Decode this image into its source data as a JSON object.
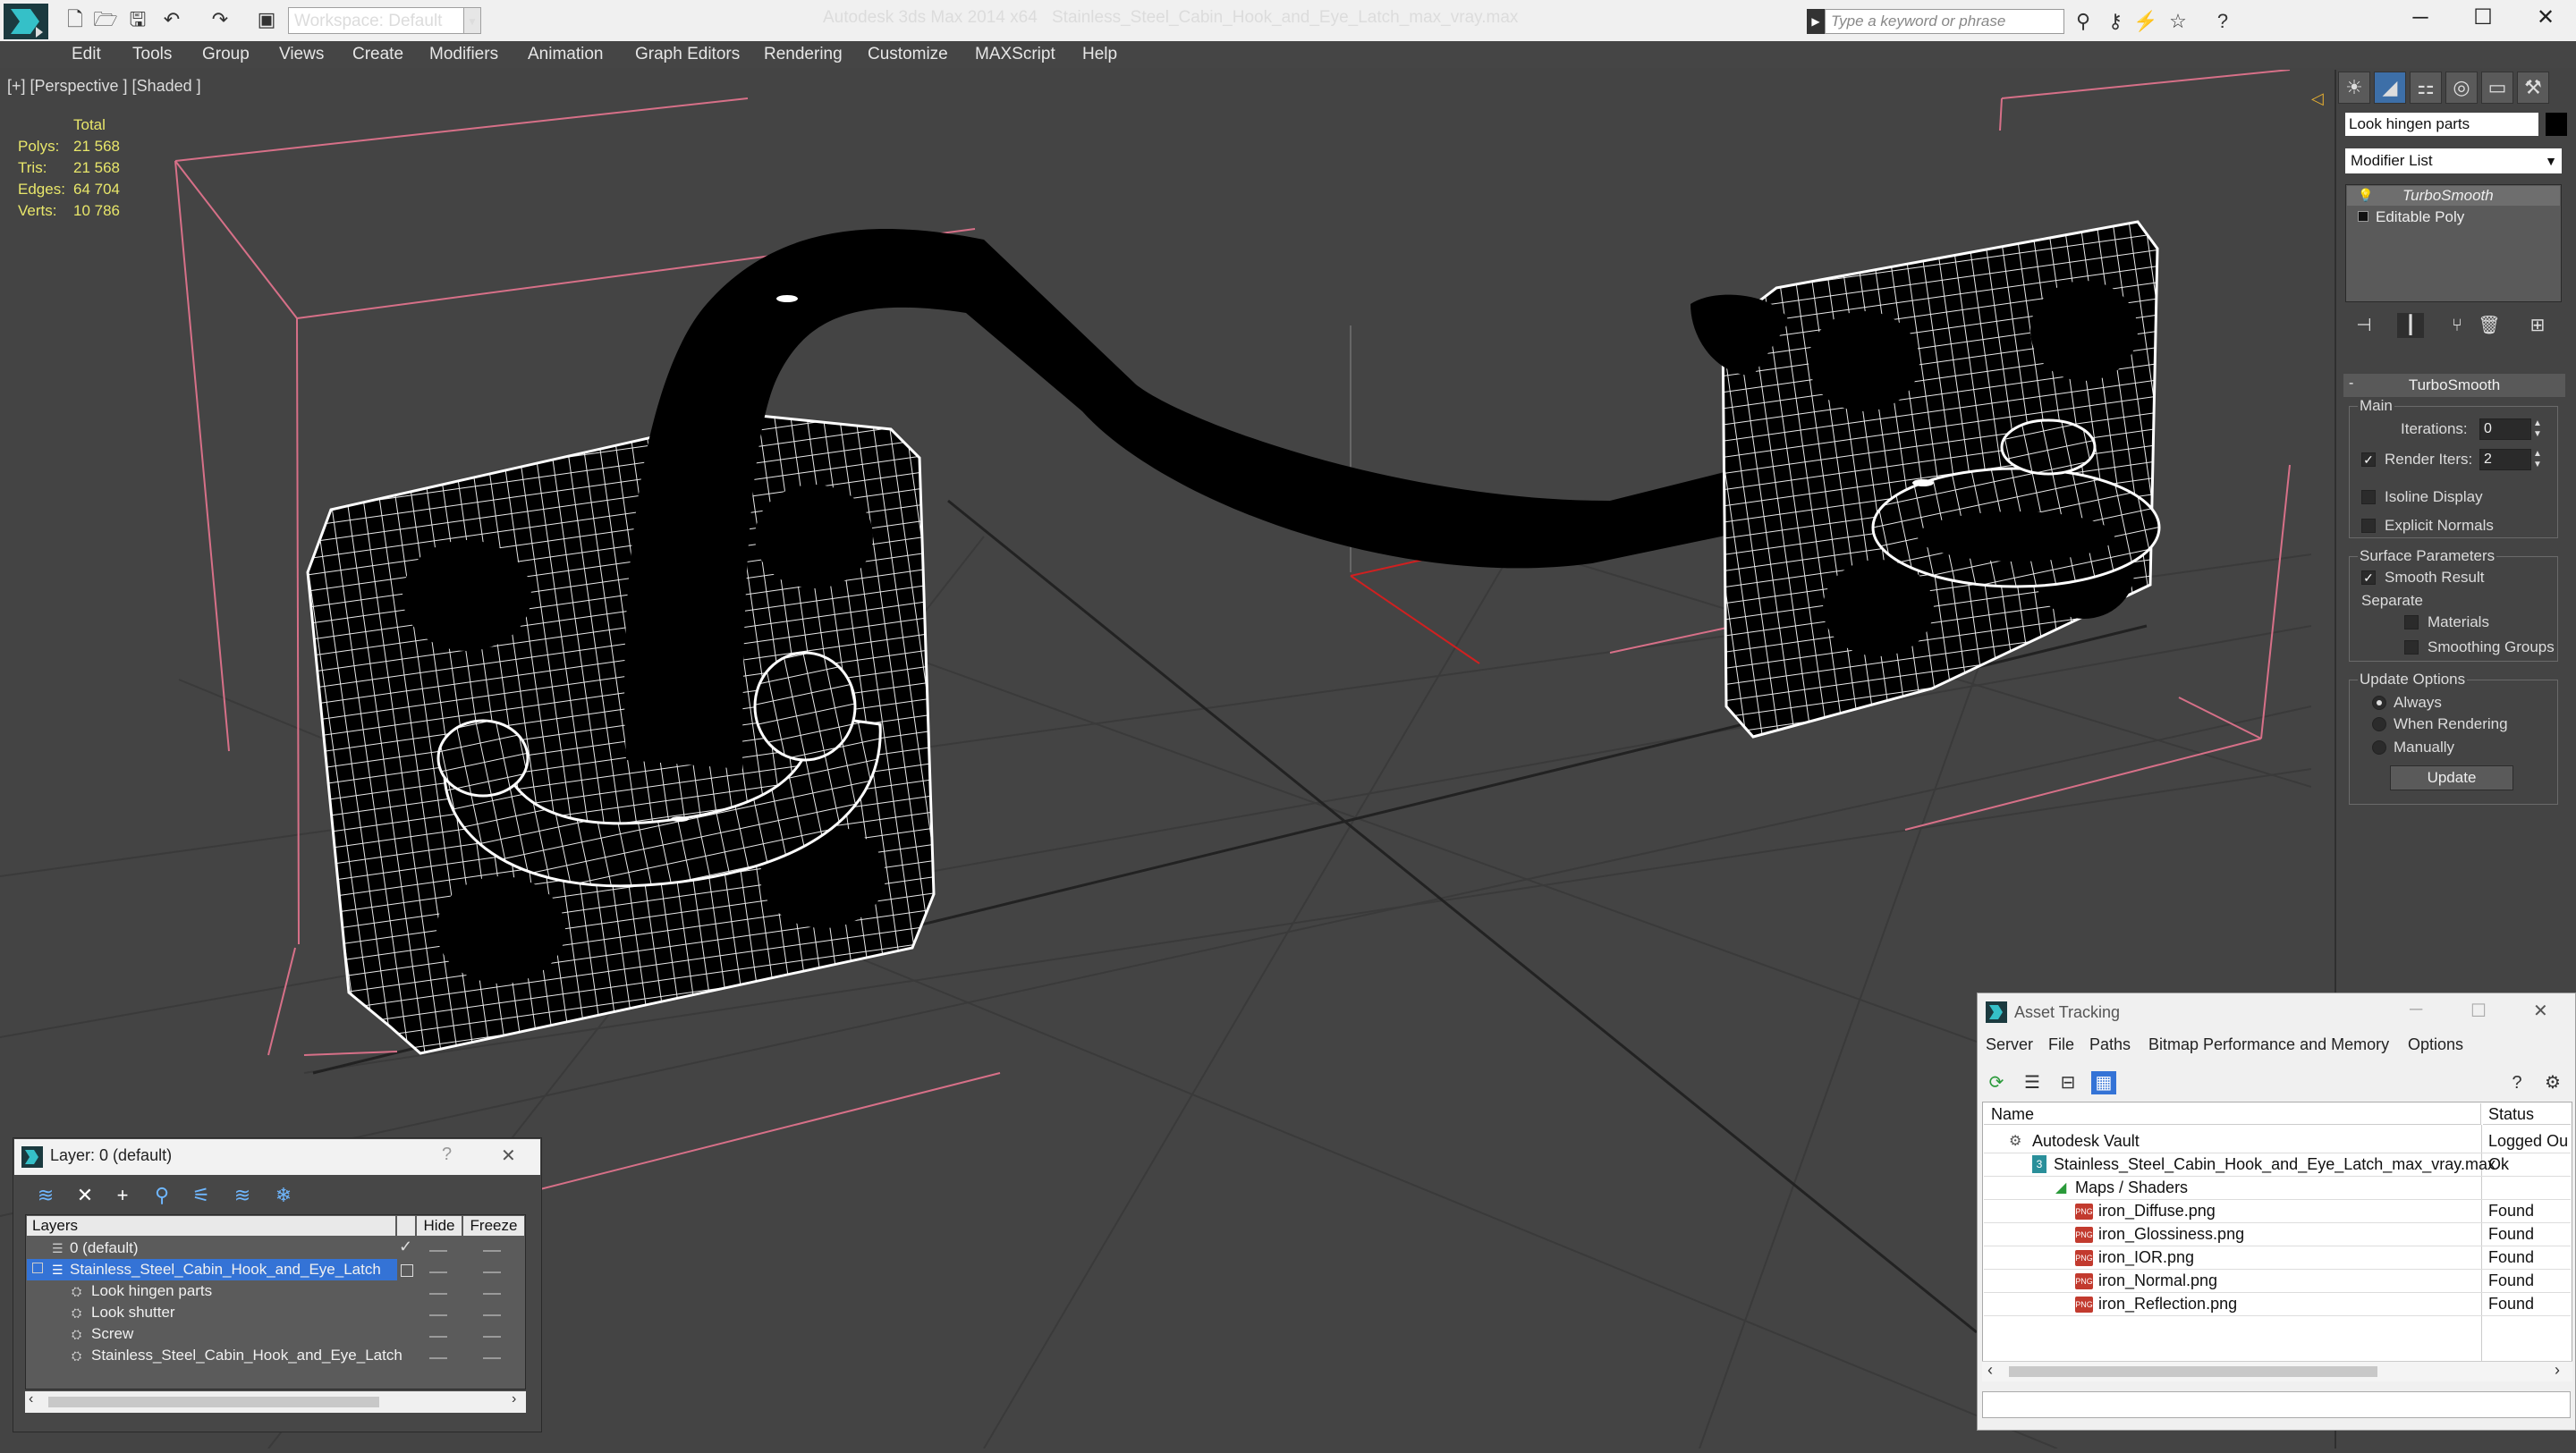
{
  "titlebar": {
    "workspace": "Workspace: Default",
    "app_title": "Autodesk 3ds Max  2014 x64",
    "file_title": "Stainless_Steel_Cabin_Hook_and_Eye_Latch_max_vray.max",
    "search_placeholder": "Type a keyword or phrase"
  },
  "menu": [
    "Edit",
    "Tools",
    "Group",
    "Views",
    "Create",
    "Modifiers",
    "Animation",
    "Graph Editors",
    "Rendering",
    "Customize",
    "MAXScript",
    "Help"
  ],
  "viewport": {
    "label": "[+] [Perspective ] [Shaded ]",
    "stats_header": "Total",
    "stats": [
      {
        "label": "Polys:",
        "value": "21 568"
      },
      {
        "label": "Tris:",
        "value": "21 568"
      },
      {
        "label": "Edges:",
        "value": "64 704"
      },
      {
        "label": "Verts:",
        "value": "10 786"
      }
    ]
  },
  "command_panel": {
    "object_name": "Look hingen parts",
    "modifier_list": "Modifier List",
    "stack": [
      "TurboSmooth",
      "Editable Poly"
    ],
    "rollout_title": "TurboSmooth",
    "main_group": "Main",
    "iterations_label": "Iterations:",
    "iterations_value": "0",
    "render_iters_label": "Render Iters:",
    "render_iters_value": "2",
    "isoline_label": "Isoline Display",
    "explicit_normals_label": "Explicit Normals",
    "surface_group": "Surface Parameters",
    "smooth_result_label": "Smooth Result",
    "separate_label": "Separate",
    "materials_label": "Materials",
    "smoothing_groups_label": "Smoothing Groups",
    "update_group": "Update Options",
    "always_label": "Always",
    "when_rendering_label": "When Rendering",
    "manually_label": "Manually",
    "update_button": "Update"
  },
  "layer_dialog": {
    "title": "Layer: 0 (default)",
    "col_layers": "Layers",
    "col_hide": "Hide",
    "col_freeze": "Freeze",
    "rows": [
      {
        "name": "0 (default)"
      },
      {
        "name": "Stainless_Steel_Cabin_Hook_and_Eye_Latch"
      },
      {
        "name": "Look hingen parts"
      },
      {
        "name": "Look shutter"
      },
      {
        "name": "Screw"
      },
      {
        "name": "Stainless_Steel_Cabin_Hook_and_Eye_Latch"
      }
    ]
  },
  "asset_tracking": {
    "title": "Asset Tracking",
    "menu": [
      "Server",
      "File",
      "Paths",
      "Bitmap Performance and Memory",
      "Options"
    ],
    "col_name": "Name",
    "col_status": "Status",
    "rows": [
      {
        "name": "Autodesk Vault",
        "status": "Logged Ou"
      },
      {
        "name": "Stainless_Steel_Cabin_Hook_and_Eye_Latch_max_vray.max",
        "status": "Ok"
      },
      {
        "name": "Maps / Shaders",
        "status": ""
      },
      {
        "name": "iron_Diffuse.png",
        "status": "Found"
      },
      {
        "name": "iron_Glossiness.png",
        "status": "Found"
      },
      {
        "name": "iron_IOR.png",
        "status": "Found"
      },
      {
        "name": "iron_Normal.png",
        "status": "Found"
      },
      {
        "name": "iron_Reflection.png",
        "status": "Found"
      }
    ],
    "png_badge": "PNG"
  }
}
